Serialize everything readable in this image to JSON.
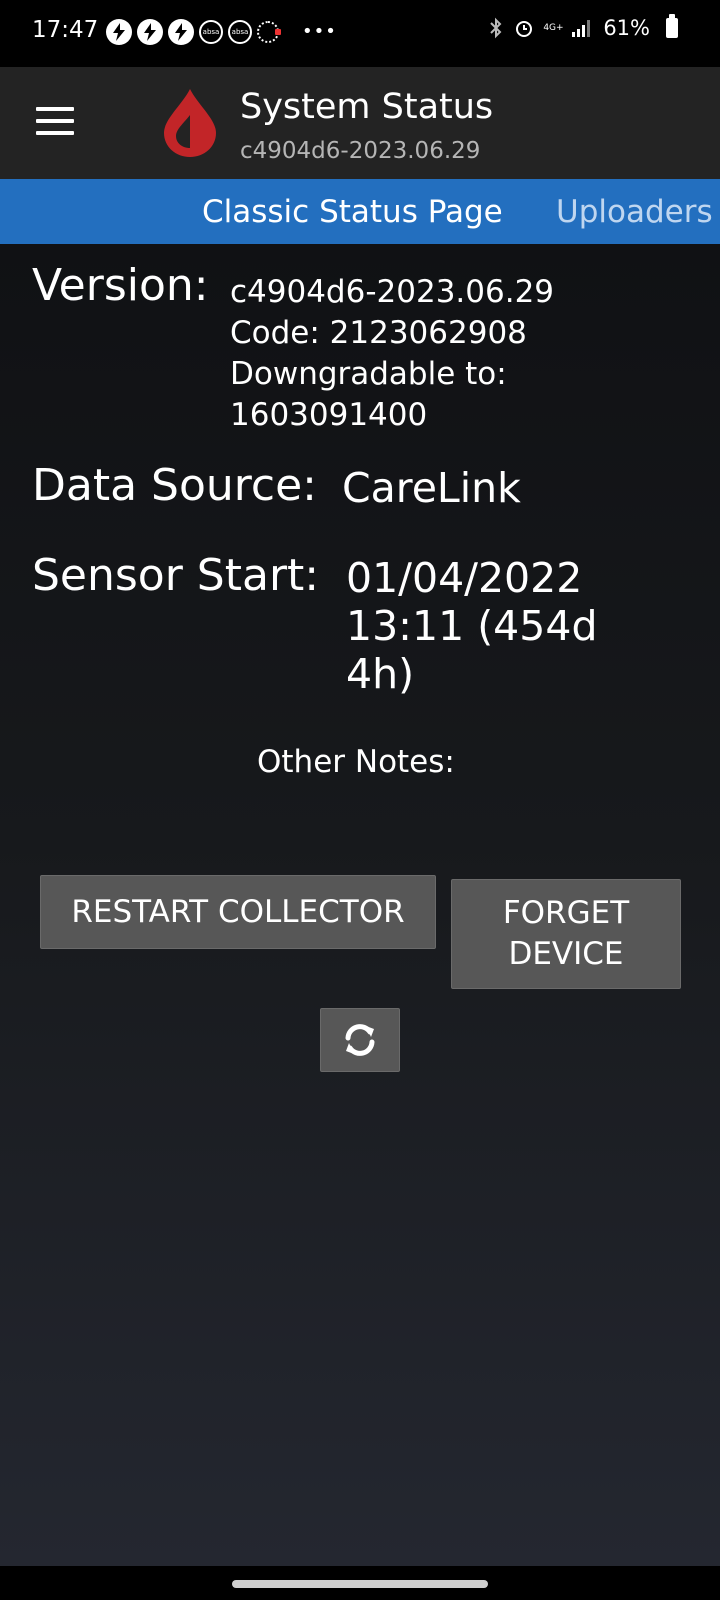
{
  "status_bar": {
    "time": "17:47",
    "notification_icons": [
      "lightning-icon",
      "lightning-icon",
      "lightning-icon",
      "absa-icon",
      "absa-icon",
      "gear-icon"
    ],
    "absa_label": "absa",
    "more_dots": "•••",
    "network_label": "4G+",
    "battery_percent": "61%"
  },
  "app_bar": {
    "title": "System Status",
    "subtitle": "c4904d6-2023.06.29",
    "logo_color": "#c22528"
  },
  "tabs": [
    {
      "label": "Classic Status Page",
      "active": true
    },
    {
      "label": "Uploaders",
      "active": false
    }
  ],
  "version": {
    "label": "Version:",
    "lines": [
      "c4904d6-2023.06.29",
      "Code: 2123062908",
      "Downgradable to:",
      "1603091400"
    ]
  },
  "data_source": {
    "label": "Data Source:",
    "value": "CareLink"
  },
  "sensor_start": {
    "label": "Sensor Start:",
    "value": "01/04/2022 13:11 (454d 4h)"
  },
  "other_notes": {
    "label": "Other Notes:"
  },
  "buttons": {
    "restart": "RESTART COLLECTOR",
    "forget_line1": "FORGET",
    "forget_line2": "DEVICE"
  },
  "colors": {
    "tab_bar": "#236fbf",
    "app_bar": "#232323",
    "button": "#575757"
  }
}
